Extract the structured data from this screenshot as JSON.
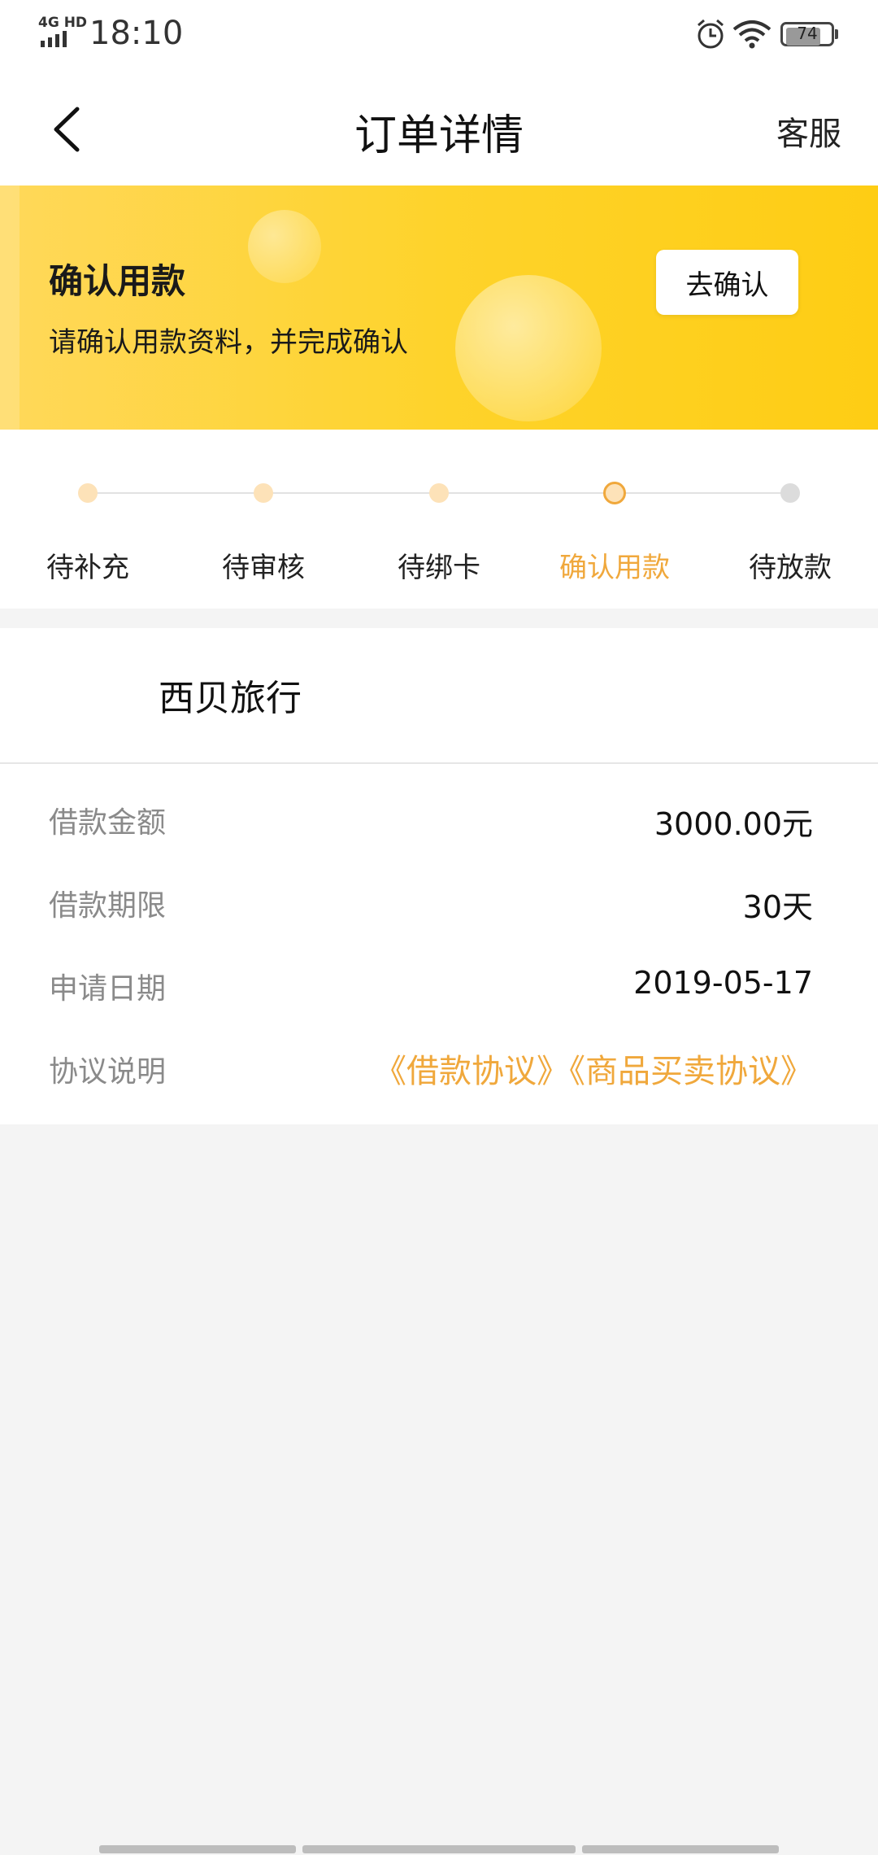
{
  "status_bar": {
    "network": "4G HD",
    "time": "18:10",
    "battery": "74"
  },
  "nav": {
    "title": "订单详情",
    "service_label": "客服"
  },
  "banner": {
    "title": "确认用款",
    "description": "请确认用款资料，并完成确认",
    "button_label": "去确认"
  },
  "steps": [
    {
      "label": "待补充",
      "state": "done"
    },
    {
      "label": "待审核",
      "state": "done"
    },
    {
      "label": "待绑卡",
      "state": "done"
    },
    {
      "label": "确认用款",
      "state": "current"
    },
    {
      "label": "待放款",
      "state": "todo"
    }
  ],
  "colors": {
    "accent": "#f0a83c",
    "banner_yellow": "#fed32b"
  },
  "order": {
    "merchant": "西贝旅行",
    "details": [
      {
        "label": "借款金额",
        "value": "3000.00元"
      },
      {
        "label": "借款期限",
        "value": "30天"
      },
      {
        "label": "申请日期",
        "value": "2019-05-17"
      }
    ],
    "agreement": {
      "label": "协议说明",
      "links": [
        "《借款协议》",
        "《商品买卖协议》"
      ]
    }
  }
}
